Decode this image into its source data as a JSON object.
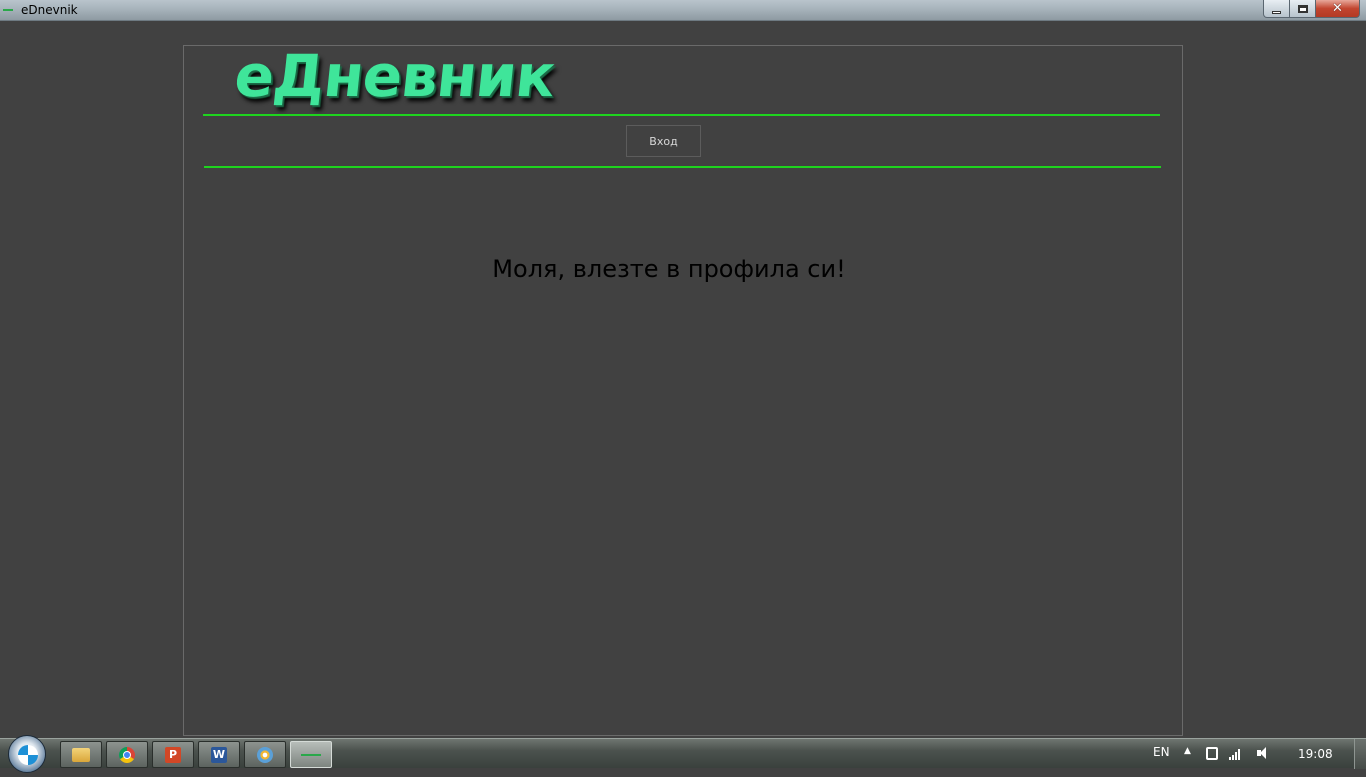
{
  "window": {
    "title": "eDnevnik",
    "controls": {
      "minimize": "minimize",
      "maximize": "maximize",
      "close": "✕"
    }
  },
  "app": {
    "logo": "еДневник",
    "nav": {
      "login_label": "Вход"
    },
    "message": "Моля, влезте в профила си!",
    "colors": {
      "background": "#414141",
      "accent": "#1ed41e",
      "logo": "#3fe59a"
    }
  },
  "taskbar": {
    "pinned": [
      "windows-explorer",
      "google-chrome",
      "powerpoint",
      "word",
      "paint",
      "ednevnik"
    ],
    "tray": {
      "language": "EN",
      "time": "19:08"
    }
  }
}
